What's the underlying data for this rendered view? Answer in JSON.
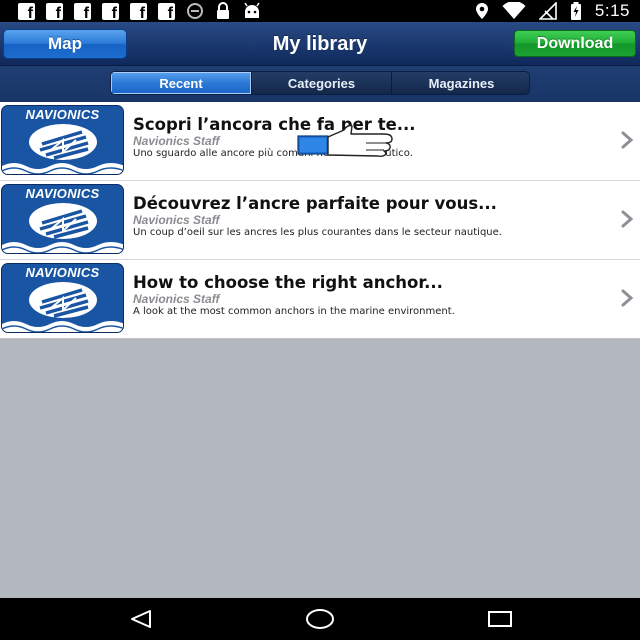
{
  "status_bar": {
    "time": "5:15",
    "left_icons": [
      "facebook-icon",
      "facebook-icon",
      "facebook-icon",
      "facebook-icon",
      "facebook-icon",
      "facebook-icon",
      "sync-icon",
      "lock-icon",
      "android-icon"
    ],
    "right_icons": [
      "location-icon",
      "wifi-icon",
      "no-signal-icon",
      "battery-charging-icon"
    ]
  },
  "nav_bar": {
    "left_button": "Map",
    "title": "My library",
    "right_button": "Download",
    "colors": {
      "bar": "#1b3a70",
      "map_button": "#2b7ad8",
      "download_button": "#1fad34"
    }
  },
  "tabs": [
    {
      "label": "Recent",
      "active": true
    },
    {
      "label": "Categories",
      "active": false
    },
    {
      "label": "Magazines",
      "active": false
    }
  ],
  "items": [
    {
      "thumb_brand": "NAVIONICS",
      "title": "Scopri l’ancora che fa per te...",
      "author": "Navionics Staff",
      "description": "Uno sguardo alle ancore più comuni nel mondo nautico."
    },
    {
      "thumb_brand": "NAVIONICS",
      "title": "Découvrez l’ancre parfaite pour vous...",
      "author": "Navionics Staff",
      "description": "Un coup d’oeil sur les ancres les plus courantes dans le secteur nautique."
    },
    {
      "thumb_brand": "NAVIONICS",
      "title": "How to choose the right anchor...",
      "author": "Navionics Staff",
      "description": "A look at the most common anchors in the marine environment."
    }
  ],
  "overlay": {
    "icon": "thumbs-up-hand-icon"
  },
  "system_nav": {
    "icons": [
      "back-icon",
      "home-icon",
      "recents-icon"
    ]
  }
}
